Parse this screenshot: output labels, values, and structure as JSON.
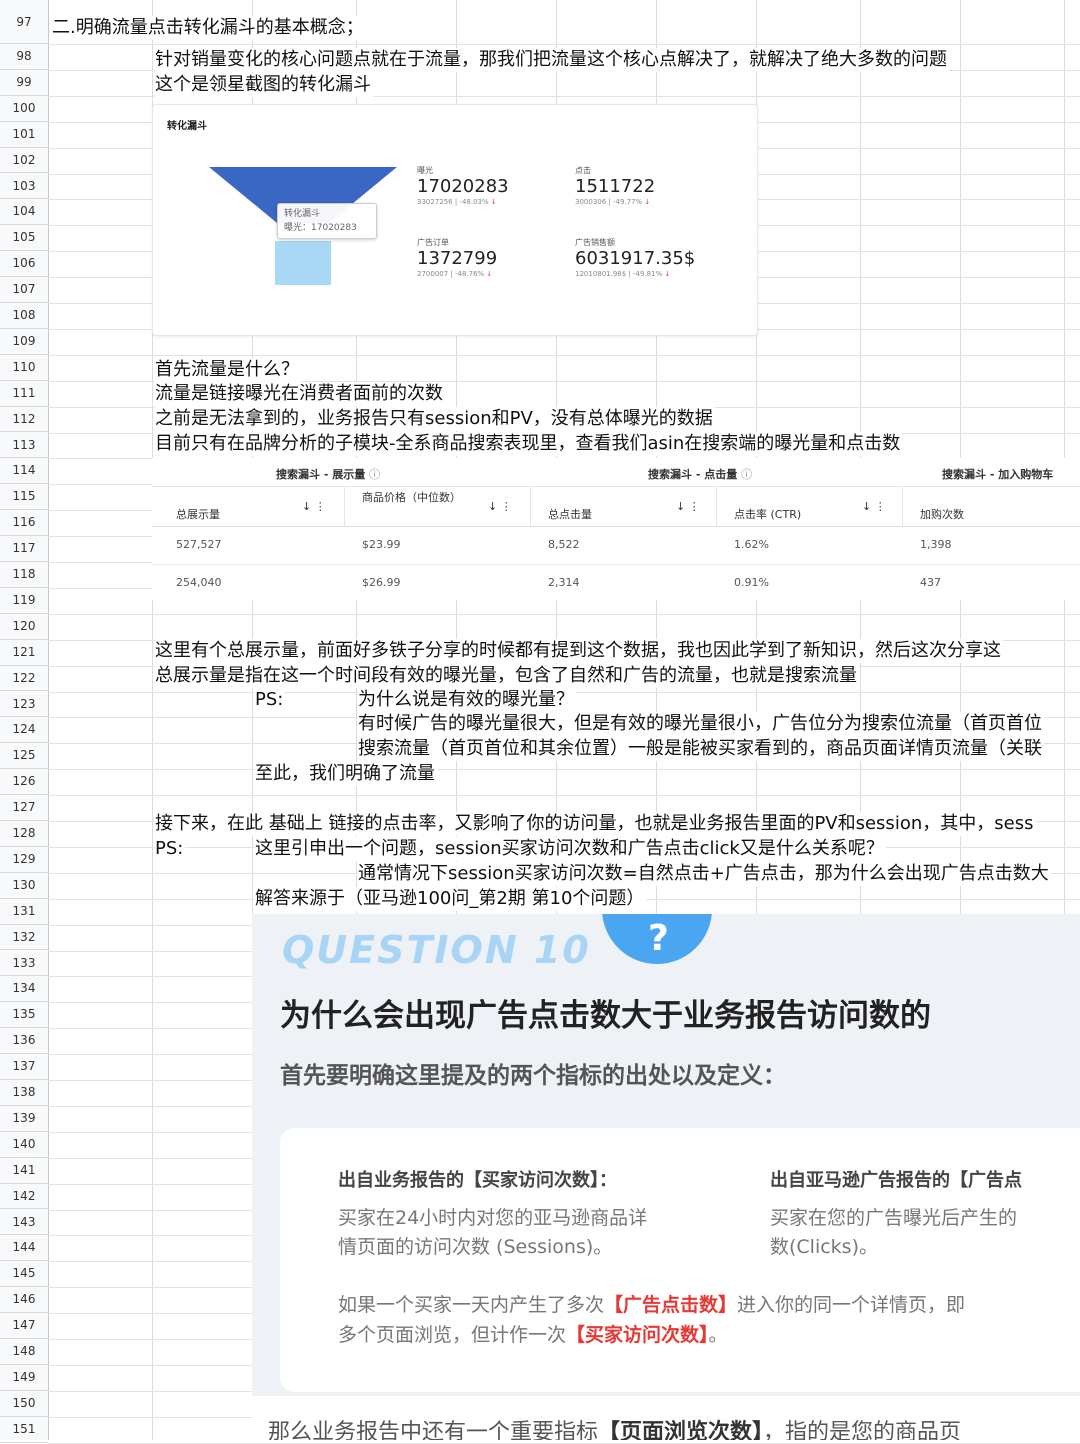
{
  "rows": [
    "97",
    "98",
    "99",
    "100",
    "101",
    "102",
    "103",
    "104",
    "105",
    "106",
    "107",
    "108",
    "109",
    "110",
    "111",
    "112",
    "113",
    "114",
    "115",
    "116",
    "117",
    "118",
    "119",
    "120",
    "121",
    "122",
    "123",
    "124",
    "125",
    "126",
    "127",
    "128",
    "129",
    "130",
    "131",
    "132",
    "133",
    "134",
    "135",
    "136",
    "137",
    "138",
    "139",
    "140",
    "141",
    "142",
    "143",
    "144",
    "145",
    "146",
    "147",
    "148",
    "149",
    "150",
    "151"
  ],
  "cells": {
    "r97": "二.明确流量点击转化漏斗的基本概念；",
    "r98": "针对销量变化的核心问题点就在于流量，那我们把流量这个核心点解决了，就解决了绝大多数的问题",
    "r99": "这个是领星截图的转化漏斗",
    "r110": "首先流量是什么？",
    "r111": "流量是链接曝光在消费者面前的次数",
    "r112": "之前是无法拿到的，业务报告只有session和PV，没有总体曝光的数据",
    "r113": "目前只有在品牌分析的子模块-全系商品搜索表现里，查看我们asin在搜索端的曝光量和点击数",
    "r121": "这里有个总展示量，前面好多铁子分享的时候都有提到这个数据，我也因此学到了新知识，然后这次分享这",
    "r122": "总展示量是指在这一个时间段有效的曝光量，包含了自然和广告的流量，也就是搜索流量",
    "r123a": "PS:",
    "r123b": "为什么说是有效的曝光量？",
    "r124": "有时候广告的曝光量很大，但是有效的曝光量很小，广告位分为搜索位流量（首页首位",
    "r125": "搜索流量（首页首位和其余位置）一般是能被买家看到的，商品页面详情页流量（关联",
    "r126": "至此，我们明确了流量",
    "r128": "接下来，在此 基础上 链接的点击率，又影响了你的访问量，也就是业务报告里面的PV和session，其中，sess",
    "r129a": "PS:",
    "r129b": "这里引申出一个问题，session买家访问次数和广告点击click又是什么关系呢？",
    "r130": "通常情况下session买家访问次数=自然点击+广告点击，那为什么会出现广告点击数大",
    "r131": "解答来源于（亚马逊100问_第2期 第10个问题）"
  },
  "funnel": {
    "title": "转化漏斗",
    "tooltip_title": "转化漏斗",
    "tooltip_value": "曝光：17020283",
    "metrics": [
      {
        "label": "曝光",
        "value": "17020283",
        "sub": "33027256 | -48.03%"
      },
      {
        "label": "点击",
        "value": "1511722",
        "sub": "3000306 | -49.77%"
      },
      {
        "label": "广告订单",
        "value": "1372799",
        "sub": "2700007 | -48.76%"
      },
      {
        "label": "广告销售额",
        "value": "6031917.35$",
        "sub": "12010801.98$ | -49.81%"
      }
    ]
  },
  "search_table": {
    "groups": [
      "搜索漏斗 - 展示量",
      "搜索漏斗 - 点击量",
      "搜索漏斗 - 加入购物车"
    ],
    "headers": [
      "总展示量",
      "商品价格（中位数）",
      "总点击量",
      "点击率 (CTR)",
      "加购次数"
    ],
    "rows": [
      [
        "527,527",
        "$23.99",
        "8,522",
        "1.62%",
        "1,398"
      ],
      [
        "254,040",
        "$26.99",
        "2,314",
        "0.91%",
        "437"
      ]
    ]
  },
  "question10": {
    "badge": "QUESTION 10",
    "title": "为什么会出现广告点击数大于业务报告访问数的",
    "subtitle": "首先要明确这里提及的两个指标的出处以及定义：",
    "left_heading": "出自业务报告的【买家访问次数】：",
    "left_body1": "买家在24小时内对您的亚马逊商品详",
    "left_body2": "情页面的访问次数 (Sessions)。",
    "right_heading": "出自亚马逊广告报告的【广告点",
    "right_body1": "买家在您的广告曝光后产生的",
    "right_body2": "数(Clicks)。",
    "para1_a": "如果一个买家一天内产生了多次",
    "para1_hl": "【广告点击数】",
    "para1_b": "进入你的同一个详情页，即",
    "para2_a": "多个页面浏览，但计作一次",
    "para2_hl": "【买家访问次数】",
    "para2_b": "。",
    "bottom_a": "那么业务报告中还有一个重要指标",
    "bottom_hl": "【页面浏览次数】",
    "bottom_b": "，指的是您的商品页"
  },
  "colors": {
    "funnel_top": "#3a66c4",
    "funnel_bottom": "#a9d8f5",
    "red": "#e53935",
    "q_blue": "#4aa6f0"
  }
}
